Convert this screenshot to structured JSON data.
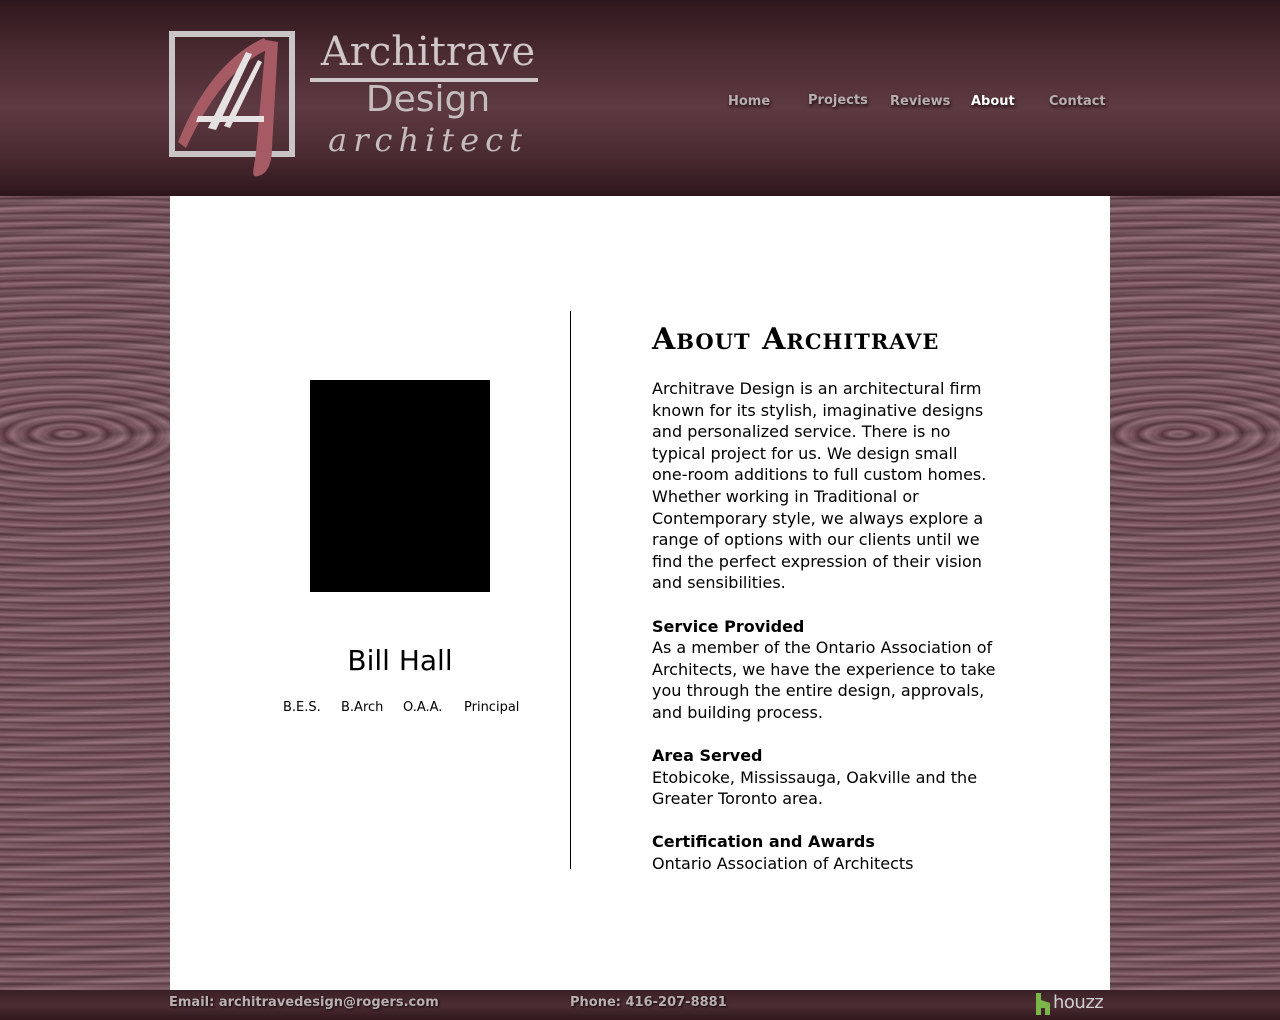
{
  "brand": {
    "line1": "Architrave",
    "line2": "Design",
    "line3": "architect",
    "monogram": "A",
    "colors": {
      "logo_text": "#cfc6c8",
      "monogram": "#a55a64",
      "frame": "#c9c4c5"
    }
  },
  "nav": {
    "items": [
      {
        "label": "Home",
        "active": false
      },
      {
        "label": "Projects",
        "active": false
      },
      {
        "label": "Reviews",
        "active": false
      },
      {
        "label": "About",
        "active": true
      },
      {
        "label": "Contact",
        "active": false
      }
    ]
  },
  "profile": {
    "name": "Bill Hall",
    "credentials": [
      "B.E.S.",
      "B.Arch",
      "O.A.A.",
      "Principal"
    ]
  },
  "about": {
    "title": "About Architrave",
    "intro": "Architrave Design is an architectural firm known for its stylish, imaginative designs and personalized service. There is no typical project for us. We design small one-room additions to full custom homes. Whether working in Traditional or Contemporary style, we always explore a range of options with our clients until we find the perfect expression of their vision and sensibilities.",
    "sections": [
      {
        "heading": "Service Provided",
        "text": "As a member of the Ontario Association of Architects, we have the experience to take you through the entire design, approvals, and building process."
      },
      {
        "heading": "Area Served",
        "text": "Etobicoke, Mississauga, Oakville and the Greater Toronto area."
      },
      {
        "heading": "Certification and Awards",
        "text": "Ontario Association of Architects"
      }
    ]
  },
  "footer": {
    "email": "Email: architravedesign@rogers.com",
    "phone": "Phone: 416-207-8881",
    "houzz_label": "houzz",
    "houzz_color": "#7ab648"
  },
  "colors": {
    "header_bg": "#4d2c33",
    "content_bg": "#ffffff",
    "nav_text": "#b7aeb0",
    "nav_active": "#ffffff"
  }
}
